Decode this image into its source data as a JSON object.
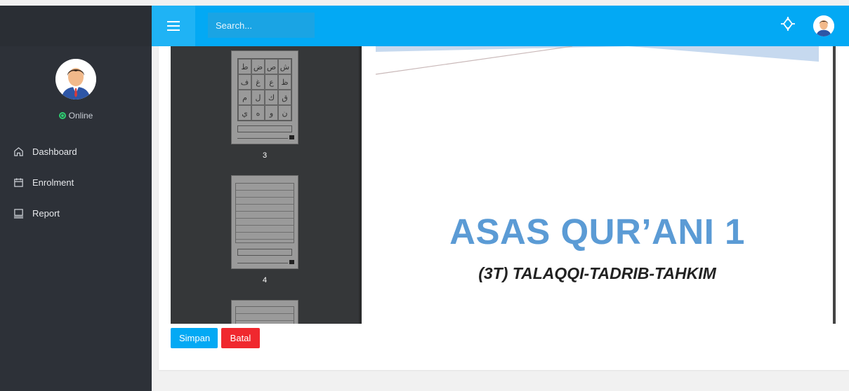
{
  "sidebar": {
    "status": "Online",
    "items": [
      {
        "label": "Dashboard",
        "icon": "home-icon"
      },
      {
        "label": "Enrolment",
        "icon": "calendar-icon"
      },
      {
        "label": "Report",
        "icon": "monitor-icon"
      }
    ]
  },
  "header": {
    "search_placeholder": "Search..."
  },
  "viewer": {
    "thumbnails": [
      {
        "label": "3"
      },
      {
        "label": "4"
      }
    ],
    "page": {
      "title": "ASAS QUR’ANI 1",
      "subtitle": "(3T) TALAQQI-TADRIB-TAHKIM"
    }
  },
  "actions": {
    "save_label": "Simpan",
    "cancel_label": "Batal"
  },
  "colors": {
    "header": "#03a9f4",
    "sidebar": "#2d3138",
    "title_blue": "#5b9bd5",
    "cancel_red": "#f0282e"
  }
}
